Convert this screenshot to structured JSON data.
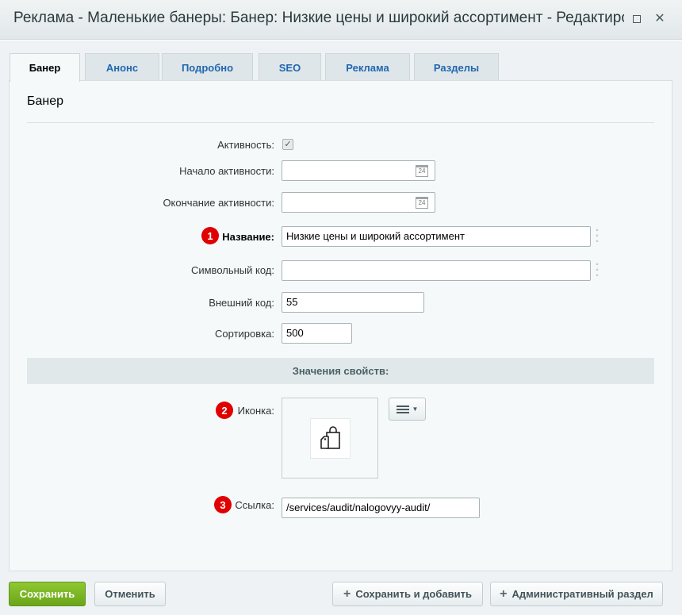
{
  "window": {
    "title": "Реклама - Маленькие банеры: Банер: Низкие цены и широкий ассортимент - Редактирование"
  },
  "tabs": [
    {
      "label": "Банер",
      "active": true
    },
    {
      "label": "Анонс",
      "active": false
    },
    {
      "label": "Подробно",
      "active": false
    },
    {
      "label": "SEO",
      "active": false
    },
    {
      "label": "Реклама",
      "active": false
    },
    {
      "label": "Разделы",
      "active": false
    }
  ],
  "panel": {
    "title": "Банер",
    "fields": {
      "active": {
        "label": "Активность:",
        "checked": true
      },
      "start": {
        "label": "Начало активности:",
        "value": ""
      },
      "end": {
        "label": "Окончание активности:",
        "value": ""
      },
      "name": {
        "label": "Название:",
        "value": "Низкие цены  и широкий ассортимент",
        "badge": "1"
      },
      "code": {
        "label": "Символьный код:",
        "value": ""
      },
      "external": {
        "label": "Внешний код:",
        "value": "55"
      },
      "sort": {
        "label": "Сортировка:",
        "value": "500"
      }
    },
    "properties_header": "Значения свойств:",
    "icon": {
      "label": "Иконка:",
      "badge": "2",
      "image": "shopping-bag-icon"
    },
    "link": {
      "label": "Ссылка:",
      "value": "/services/audit/nalogovyy-audit/",
      "badge": "3"
    }
  },
  "buttons": {
    "save": "Сохранить",
    "cancel": "Отменить",
    "save_add": "Сохранить и добавить",
    "admin": "Административный раздел"
  },
  "colors": {
    "accent_green": "#6ba519",
    "tab_link": "#2067b0",
    "badge_red": "#e00000"
  }
}
